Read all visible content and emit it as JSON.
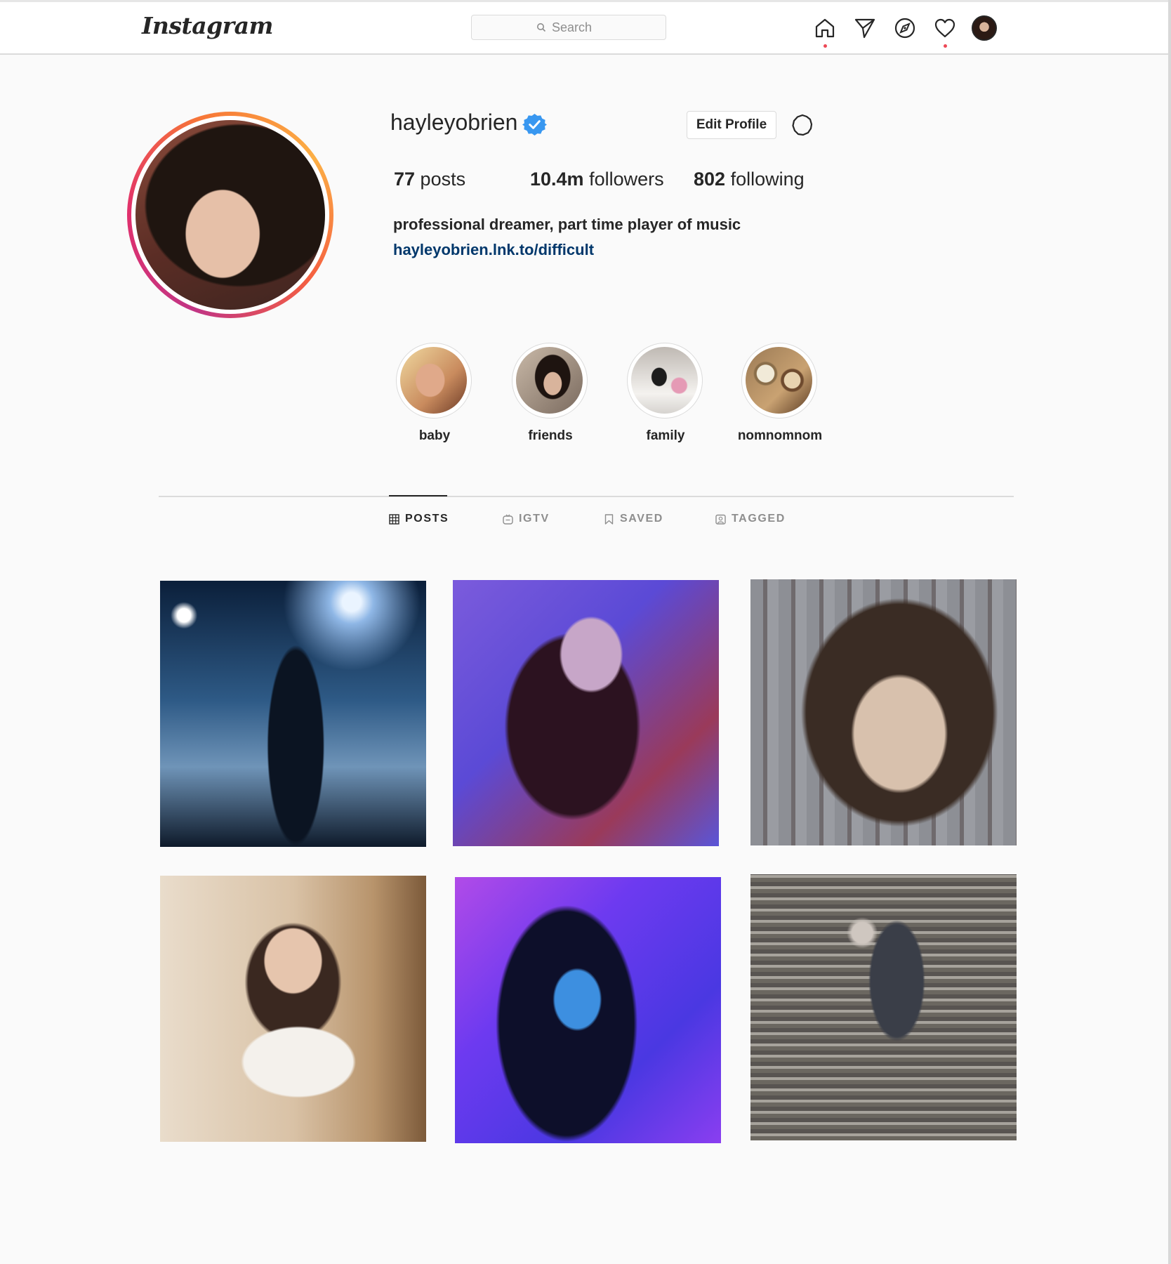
{
  "header": {
    "logo": "Instagram",
    "search_placeholder": "Search",
    "nav": [
      "home-icon",
      "direct-icon",
      "explore-icon",
      "activity-icon",
      "profile-avatar"
    ]
  },
  "profile": {
    "username": "hayleyobrien",
    "verified": true,
    "edit_label": "Edit Profile",
    "posts_count": "77",
    "posts_label": " posts",
    "followers_count": "10.4m",
    "followers_label": " followers",
    "following_count": "802",
    "following_label": " following",
    "bio": "professional dreamer, part time player of music",
    "link": "hayleyobrien.lnk.to/difficult"
  },
  "highlights": [
    {
      "label": "baby"
    },
    {
      "label": "friends"
    },
    {
      "label": "family"
    },
    {
      "label": "nomnomnom"
    }
  ],
  "tabs": [
    {
      "label": "POSTS",
      "active": true
    },
    {
      "label": "IGTV",
      "active": false
    },
    {
      "label": "SAVED",
      "active": false
    },
    {
      "label": "TAGGED",
      "active": false
    }
  ],
  "posts_visible": 6,
  "colors": {
    "verified": "#3897f0",
    "link": "#00376b",
    "notification_dot": "#ed4956"
  }
}
